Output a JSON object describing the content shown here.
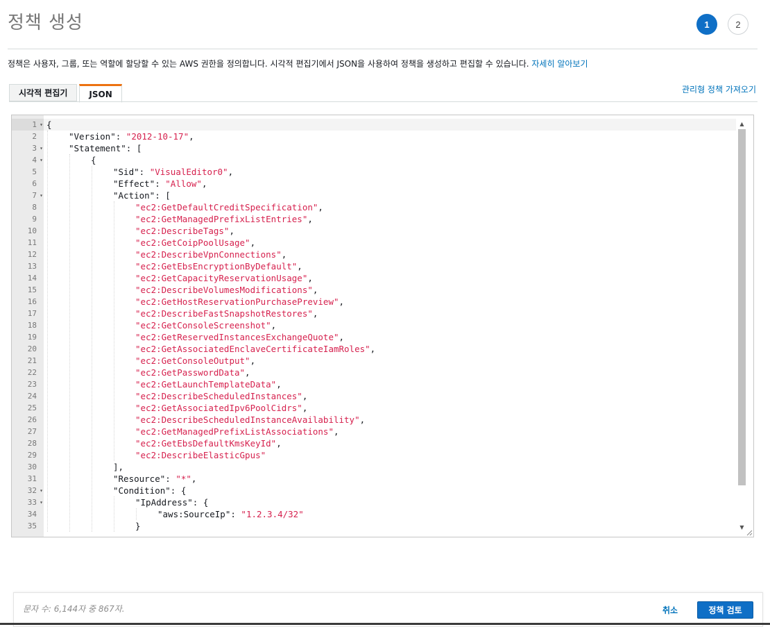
{
  "header": {
    "title": "정책 생성",
    "steps": [
      "1",
      "2"
    ]
  },
  "description": {
    "text": "정책은 사용자, 그룹, 또는 역할에 할당할 수 있는 AWS 권한을 정의합니다. 시각적 편집기에서 JSON을 사용하여 정책을 생성하고 편집할 수 있습니다.",
    "link": "자세히 알아보기"
  },
  "tabs": [
    {
      "label": "시각적 편집기",
      "active": false
    },
    {
      "label": "JSON",
      "active": true
    }
  ],
  "import_link": "관리형 정책 가져오기",
  "editor": {
    "current_line": 1,
    "lines": [
      {
        "n": "1",
        "fold": true,
        "indent": 0,
        "parts": [
          [
            "p",
            "{"
          ]
        ]
      },
      {
        "n": "2",
        "fold": false,
        "indent": 1,
        "parts": [
          [
            "p",
            "\"Version\": "
          ],
          [
            "s",
            "\"2012-10-17\""
          ],
          [
            "p",
            ","
          ]
        ]
      },
      {
        "n": "3",
        "fold": true,
        "indent": 1,
        "parts": [
          [
            "p",
            "\"Statement\": ["
          ]
        ]
      },
      {
        "n": "4",
        "fold": true,
        "indent": 2,
        "parts": [
          [
            "p",
            "{"
          ]
        ]
      },
      {
        "n": "5",
        "fold": false,
        "indent": 3,
        "parts": [
          [
            "p",
            "\"Sid\": "
          ],
          [
            "s",
            "\"VisualEditor0\""
          ],
          [
            "p",
            ","
          ]
        ]
      },
      {
        "n": "6",
        "fold": false,
        "indent": 3,
        "parts": [
          [
            "p",
            "\"Effect\": "
          ],
          [
            "s",
            "\"Allow\""
          ],
          [
            "p",
            ","
          ]
        ]
      },
      {
        "n": "7",
        "fold": true,
        "indent": 3,
        "parts": [
          [
            "p",
            "\"Action\": ["
          ]
        ]
      },
      {
        "n": "8",
        "fold": false,
        "indent": 4,
        "parts": [
          [
            "s",
            "\"ec2:GetDefaultCreditSpecification\""
          ],
          [
            "p",
            ","
          ]
        ]
      },
      {
        "n": "9",
        "fold": false,
        "indent": 4,
        "parts": [
          [
            "s",
            "\"ec2:GetManagedPrefixListEntries\""
          ],
          [
            "p",
            ","
          ]
        ]
      },
      {
        "n": "10",
        "fold": false,
        "indent": 4,
        "parts": [
          [
            "s",
            "\"ec2:DescribeTags\""
          ],
          [
            "p",
            ","
          ]
        ]
      },
      {
        "n": "11",
        "fold": false,
        "indent": 4,
        "parts": [
          [
            "s",
            "\"ec2:GetCoipPoolUsage\""
          ],
          [
            "p",
            ","
          ]
        ]
      },
      {
        "n": "12",
        "fold": false,
        "indent": 4,
        "parts": [
          [
            "s",
            "\"ec2:DescribeVpnConnections\""
          ],
          [
            "p",
            ","
          ]
        ]
      },
      {
        "n": "13",
        "fold": false,
        "indent": 4,
        "parts": [
          [
            "s",
            "\"ec2:GetEbsEncryptionByDefault\""
          ],
          [
            "p",
            ","
          ]
        ]
      },
      {
        "n": "14",
        "fold": false,
        "indent": 4,
        "parts": [
          [
            "s",
            "\"ec2:GetCapacityReservationUsage\""
          ],
          [
            "p",
            ","
          ]
        ]
      },
      {
        "n": "15",
        "fold": false,
        "indent": 4,
        "parts": [
          [
            "s",
            "\"ec2:DescribeVolumesModifications\""
          ],
          [
            "p",
            ","
          ]
        ]
      },
      {
        "n": "16",
        "fold": false,
        "indent": 4,
        "parts": [
          [
            "s",
            "\"ec2:GetHostReservationPurchasePreview\""
          ],
          [
            "p",
            ","
          ]
        ]
      },
      {
        "n": "17",
        "fold": false,
        "indent": 4,
        "parts": [
          [
            "s",
            "\"ec2:DescribeFastSnapshotRestores\""
          ],
          [
            "p",
            ","
          ]
        ]
      },
      {
        "n": "18",
        "fold": false,
        "indent": 4,
        "parts": [
          [
            "s",
            "\"ec2:GetConsoleScreenshot\""
          ],
          [
            "p",
            ","
          ]
        ]
      },
      {
        "n": "19",
        "fold": false,
        "indent": 4,
        "parts": [
          [
            "s",
            "\"ec2:GetReservedInstancesExchangeQuote\""
          ],
          [
            "p",
            ","
          ]
        ]
      },
      {
        "n": "20",
        "fold": false,
        "indent": 4,
        "parts": [
          [
            "s",
            "\"ec2:GetAssociatedEnclaveCertificateIamRoles\""
          ],
          [
            "p",
            ","
          ]
        ]
      },
      {
        "n": "21",
        "fold": false,
        "indent": 4,
        "parts": [
          [
            "s",
            "\"ec2:GetConsoleOutput\""
          ],
          [
            "p",
            ","
          ]
        ]
      },
      {
        "n": "22",
        "fold": false,
        "indent": 4,
        "parts": [
          [
            "s",
            "\"ec2:GetPasswordData\""
          ],
          [
            "p",
            ","
          ]
        ]
      },
      {
        "n": "23",
        "fold": false,
        "indent": 4,
        "parts": [
          [
            "s",
            "\"ec2:GetLaunchTemplateData\""
          ],
          [
            "p",
            ","
          ]
        ]
      },
      {
        "n": "24",
        "fold": false,
        "indent": 4,
        "parts": [
          [
            "s",
            "\"ec2:DescribeScheduledInstances\""
          ],
          [
            "p",
            ","
          ]
        ]
      },
      {
        "n": "25",
        "fold": false,
        "indent": 4,
        "parts": [
          [
            "s",
            "\"ec2:GetAssociatedIpv6PoolCidrs\""
          ],
          [
            "p",
            ","
          ]
        ]
      },
      {
        "n": "26",
        "fold": false,
        "indent": 4,
        "parts": [
          [
            "s",
            "\"ec2:DescribeScheduledInstanceAvailability\""
          ],
          [
            "p",
            ","
          ]
        ]
      },
      {
        "n": "27",
        "fold": false,
        "indent": 4,
        "parts": [
          [
            "s",
            "\"ec2:GetManagedPrefixListAssociations\""
          ],
          [
            "p",
            ","
          ]
        ]
      },
      {
        "n": "28",
        "fold": false,
        "indent": 4,
        "parts": [
          [
            "s",
            "\"ec2:GetEbsDefaultKmsKeyId\""
          ],
          [
            "p",
            ","
          ]
        ]
      },
      {
        "n": "29",
        "fold": false,
        "indent": 4,
        "parts": [
          [
            "s",
            "\"ec2:DescribeElasticGpus\""
          ]
        ]
      },
      {
        "n": "30",
        "fold": false,
        "indent": 3,
        "parts": [
          [
            "p",
            "],"
          ]
        ]
      },
      {
        "n": "31",
        "fold": false,
        "indent": 3,
        "parts": [
          [
            "p",
            "\"Resource\": "
          ],
          [
            "s",
            "\"*\""
          ],
          [
            "p",
            ","
          ]
        ]
      },
      {
        "n": "32",
        "fold": true,
        "indent": 3,
        "parts": [
          [
            "p",
            "\"Condition\": {"
          ]
        ]
      },
      {
        "n": "33",
        "fold": true,
        "indent": 4,
        "parts": [
          [
            "p",
            "\"IpAddress\": {"
          ]
        ]
      },
      {
        "n": "34",
        "fold": false,
        "indent": 5,
        "parts": [
          [
            "p",
            "\"aws:SourceIp\": "
          ],
          [
            "s",
            "\"1.2.3.4/32\""
          ]
        ]
      },
      {
        "n": "35",
        "fold": false,
        "indent": 4,
        "parts": [
          [
            "p",
            "}"
          ]
        ]
      }
    ]
  },
  "footer": {
    "char_count": "문자 수: 6,144자 중 867자.",
    "cancel_label": "취소",
    "review_label": "정책 검토"
  }
}
